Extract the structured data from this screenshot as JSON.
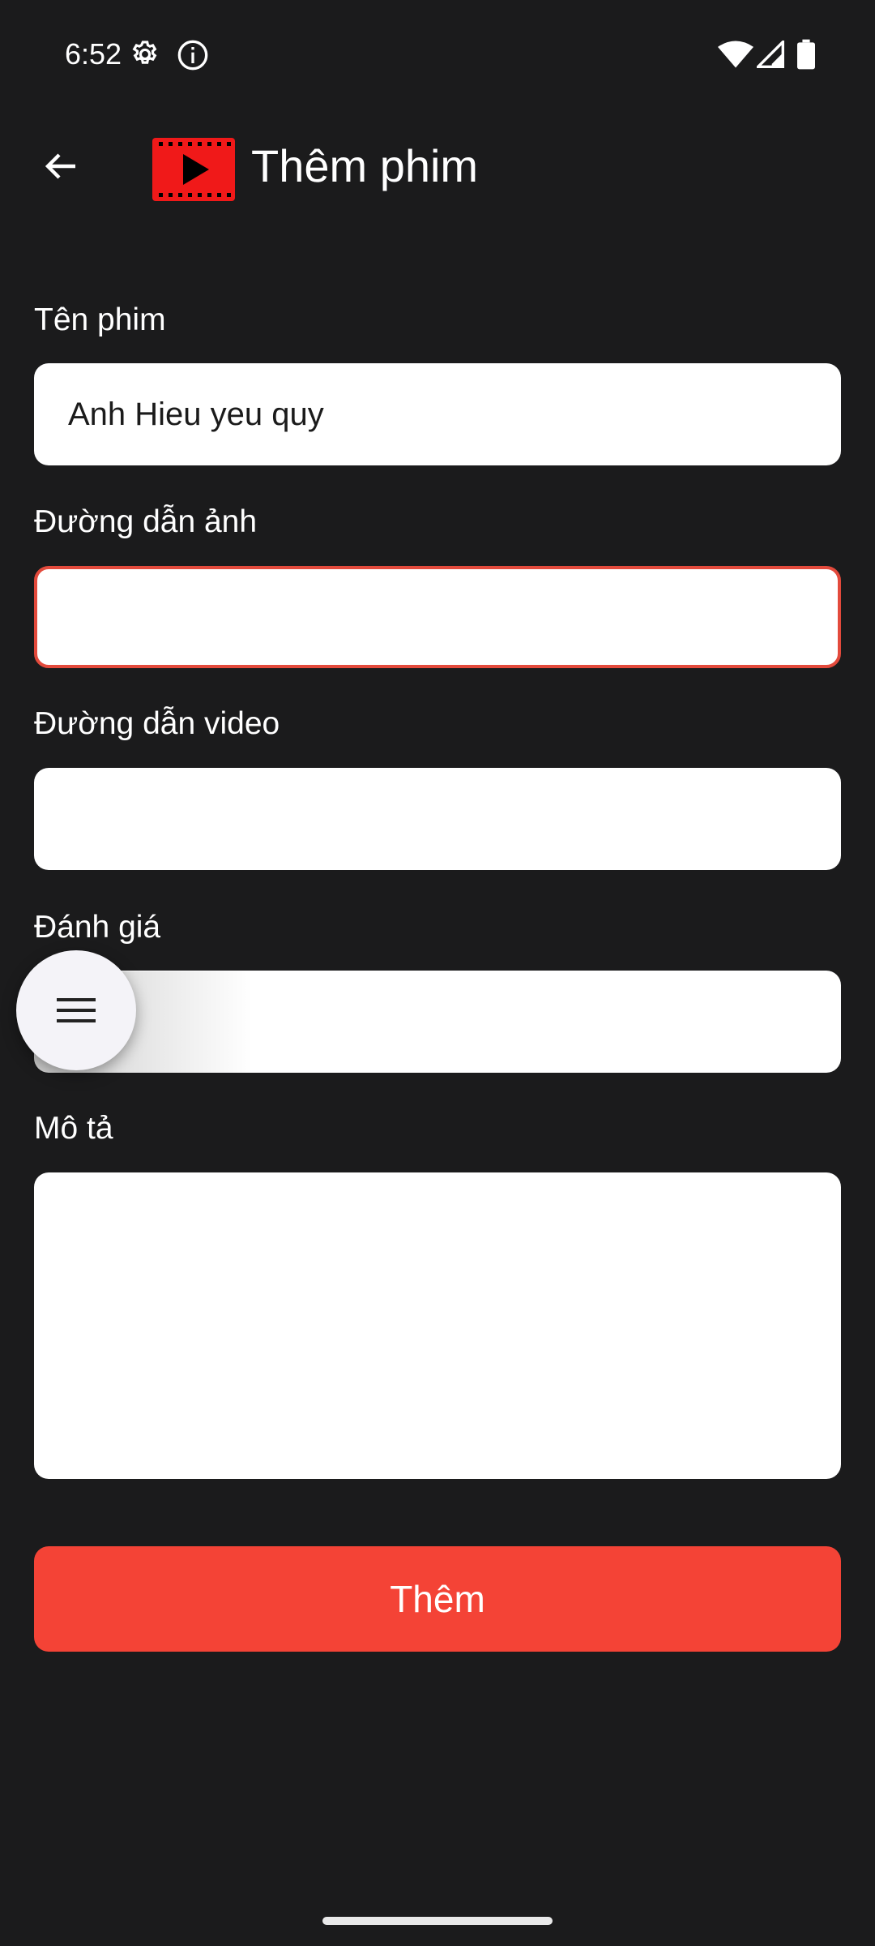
{
  "status_bar": {
    "time": "6:52",
    "icons": [
      "gear-icon",
      "info-icon",
      "wifi-icon",
      "signal-icon",
      "battery-icon"
    ]
  },
  "app_bar": {
    "title": "Thêm phim",
    "back_icon": "arrow-left-icon",
    "logo_icon": "film-play-icon"
  },
  "form": {
    "fields": [
      {
        "label": "Tên phim",
        "value": "Anh Hieu yeu quy"
      },
      {
        "label": "Đường dẫn ảnh",
        "value": ""
      },
      {
        "label": "Đường dẫn video",
        "value": ""
      },
      {
        "label": "Đánh giá",
        "value": ""
      },
      {
        "label": "Mô tả",
        "value": ""
      }
    ],
    "submit_label": "Thêm"
  },
  "floating_menu": {
    "icon": "menu-icon"
  },
  "colors": {
    "background": "#1b1b1c",
    "accent": "#f44336",
    "error_border": "#e34a3c",
    "input_bg": "#ffffff"
  }
}
